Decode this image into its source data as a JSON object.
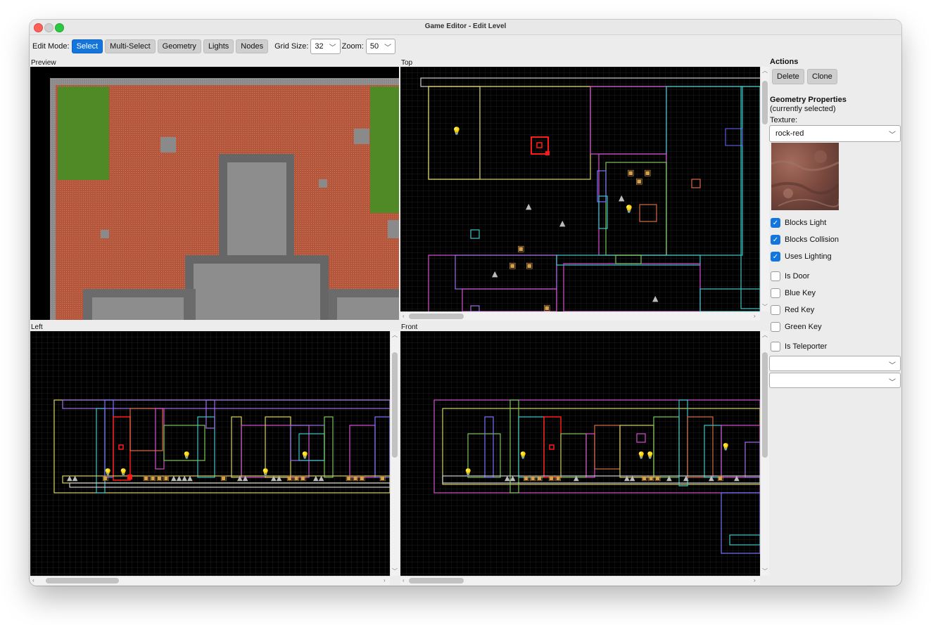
{
  "window": {
    "title": "Game Editor - Edit Level"
  },
  "toolbar": {
    "edit_mode_label": "Edit Mode:",
    "modes": [
      "Select",
      "Multi-Select",
      "Geometry",
      "Lights",
      "Nodes"
    ],
    "active_mode": "Select",
    "grid_size_label": "Grid Size:",
    "grid_size_value": "32",
    "zoom_label": "Zoom:",
    "zoom_value": "50"
  },
  "views": {
    "preview_label": "Preview",
    "top_label": "Top",
    "left_label": "Left",
    "front_label": "Front"
  },
  "sidebar": {
    "actions_heading": "Actions",
    "delete_label": "Delete",
    "clone_label": "Clone",
    "geometry_heading": "Geometry Properties",
    "geometry_sub": "(currently selected)",
    "texture_label": "Texture:",
    "texture_value": "rock-red",
    "checks": [
      {
        "label": "Blocks Light",
        "checked": true
      },
      {
        "label": "Blocks Collision",
        "checked": true
      },
      {
        "label": "Uses Lighting",
        "checked": true
      },
      {
        "label": "Is Door",
        "checked": false
      },
      {
        "label": "Blue Key",
        "checked": false
      },
      {
        "label": "Red Key",
        "checked": false
      },
      {
        "label": "Green Key",
        "checked": false
      },
      {
        "label": "Is Teleporter",
        "checked": false
      }
    ],
    "extra_select_1": "",
    "extra_select_2": ""
  },
  "colors": {
    "accent": "#1476dd",
    "viewport_bg": "#000000",
    "floor_red": "#b4563c",
    "grass_green": "#4f8a26",
    "stone_gray": "#7a7a7a",
    "selection_red": "#ff1a1a"
  },
  "icons": [
    "light-bulb-icon",
    "crate-icon",
    "enemy-node-icon",
    "chevron-down-icon",
    "checkmark-icon"
  ]
}
